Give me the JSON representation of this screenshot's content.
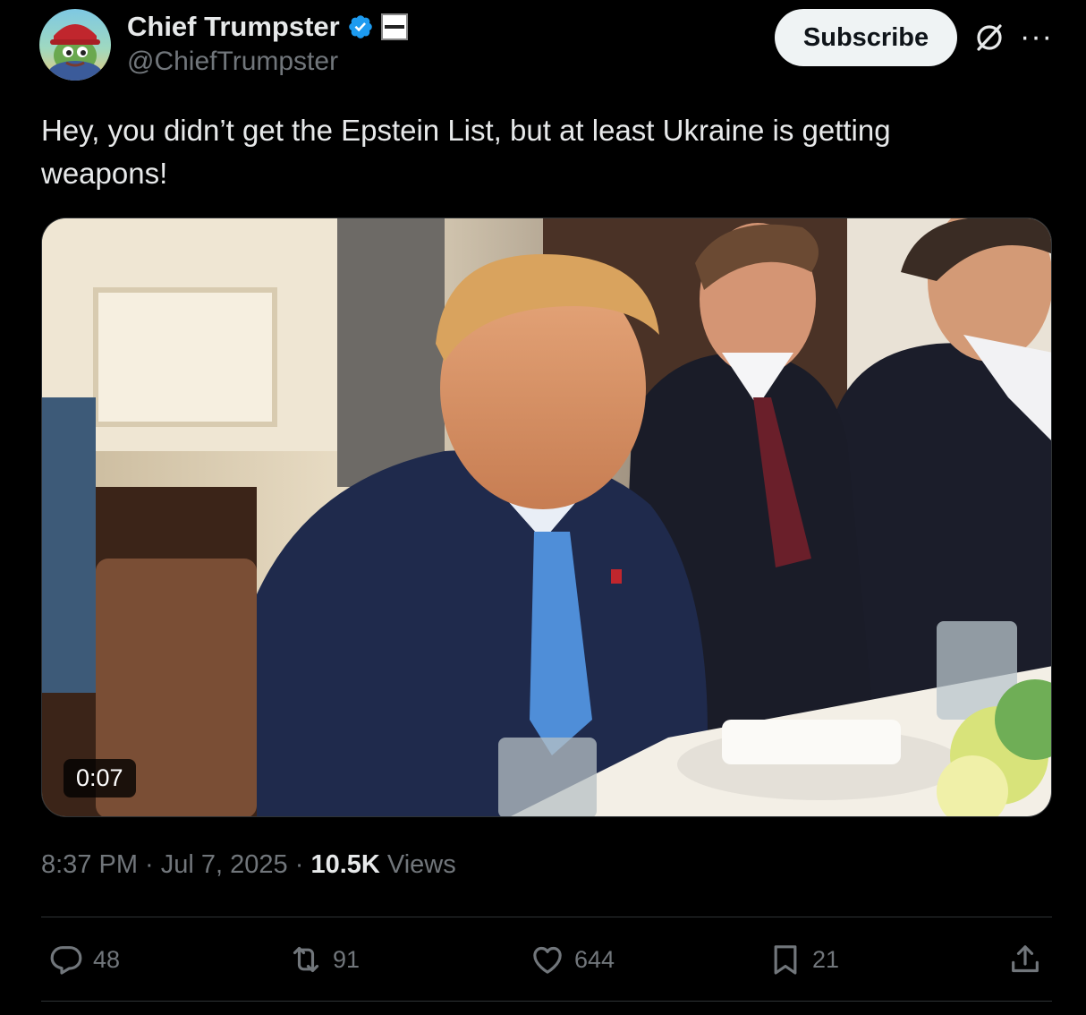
{
  "author": {
    "display_name": "Chief Trumpster",
    "handle": "@ChiefTrumpster"
  },
  "header": {
    "subscribe_label": "Subscribe",
    "more_label": "···"
  },
  "tweet": {
    "text": "Hey, you didn’t get the Epstein List, but at least Ukraine is getting weapons!",
    "media": {
      "duration": "0:07"
    },
    "time": "8:37 PM",
    "sep1": " · ",
    "date": "Jul 7, 2025",
    "sep2": " · ",
    "views_count": "10.5K",
    "views_label": " Views"
  },
  "actions": {
    "replies": "48",
    "reposts": "91",
    "likes": "644",
    "bookmarks": "21"
  },
  "colors": {
    "background": "#000000",
    "text": "#e7e9ea",
    "muted": "#71767b",
    "verified": "#1d9bf0",
    "divider": "#2f3336"
  }
}
